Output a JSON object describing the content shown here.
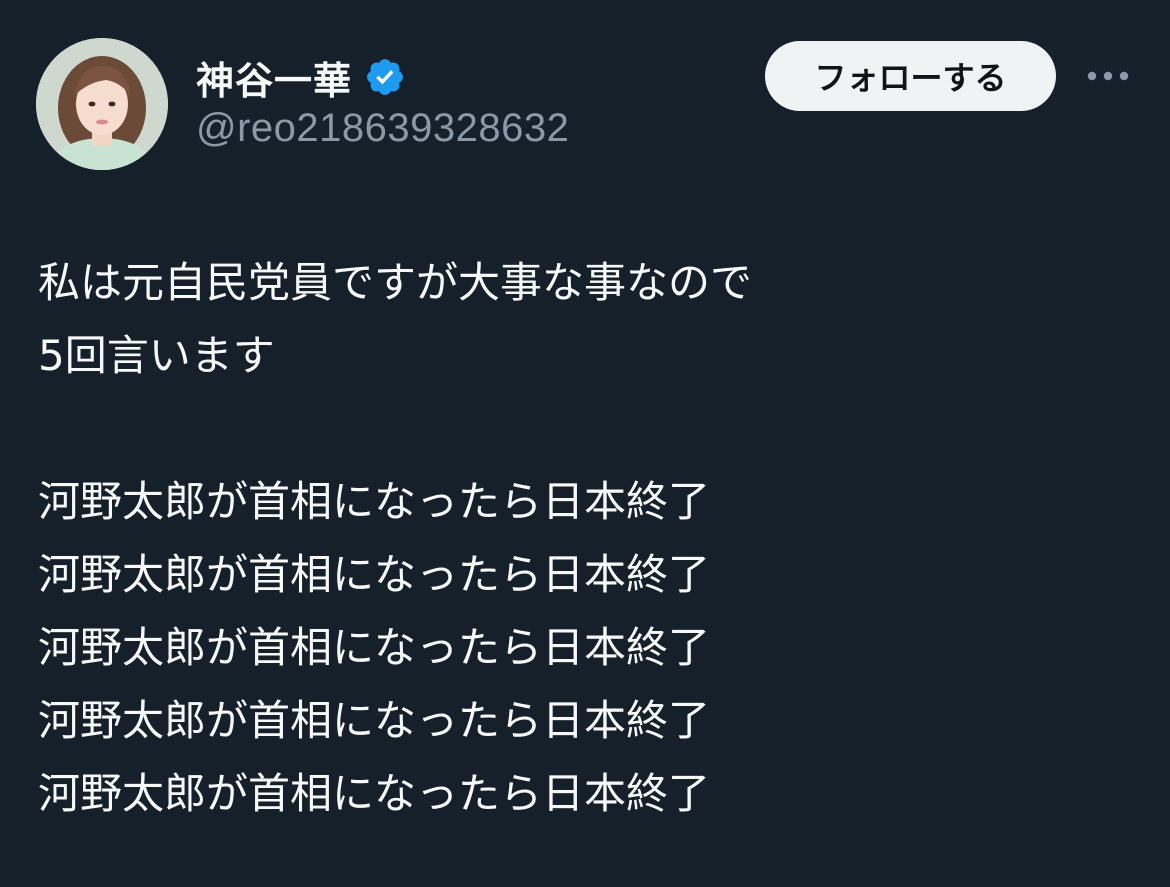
{
  "author": {
    "display_name": "神谷一華",
    "handle": "@reo218639328632",
    "verified_icon": "verified-badge-icon",
    "avatar_icon": "profile-photo"
  },
  "actions": {
    "follow_label": "フォローする",
    "more_icon": "more-options-icon"
  },
  "tweet": {
    "intro_lines": [
      "私は元自民党員ですが大事な事なので",
      "5回言います"
    ],
    "repeated_lines": [
      "河野太郎が首相になったら日本終了",
      "河野太郎が首相になったら日本終了",
      "河野太郎が首相になったら日本終了",
      "河野太郎が首相になったら日本終了",
      "河野太郎が首相になったら日本終了"
    ]
  },
  "colors": {
    "background": "#15202b",
    "text": "#f7f9f9",
    "secondary_text": "#8b98a5",
    "verified": "#1d9bf0",
    "follow_button_bg": "#eff3f4"
  }
}
